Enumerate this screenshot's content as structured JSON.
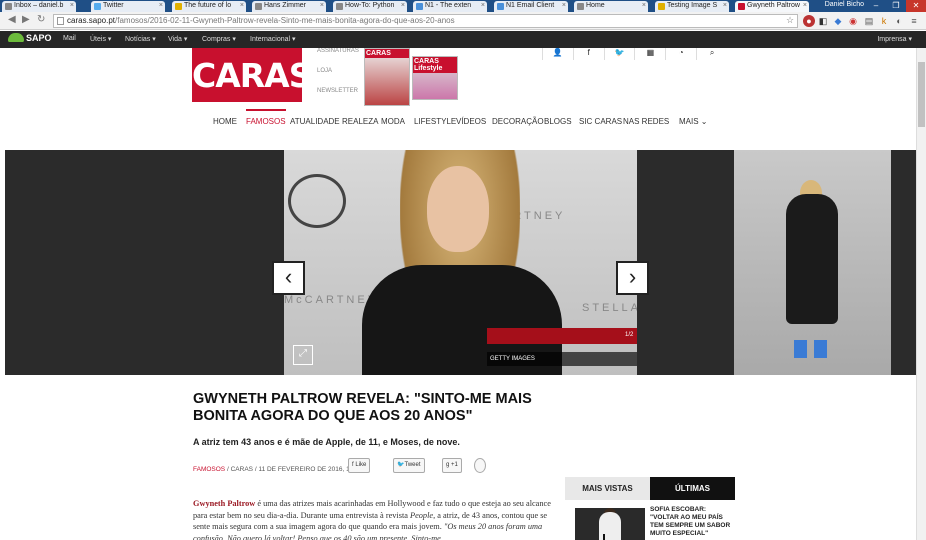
{
  "browser": {
    "tabs": [
      {
        "title": "Inbox – daniel.b",
        "active": false
      },
      {
        "title": "Twitter",
        "active": false
      },
      {
        "title": "The future of lo",
        "active": false
      },
      {
        "title": "Hans Zimmer",
        "active": false
      },
      {
        "title": "How-To: Python",
        "active": false
      },
      {
        "title": "N1 - The exten",
        "active": false
      },
      {
        "title": "N1 Email Client",
        "active": false
      },
      {
        "title": "Home",
        "active": false
      },
      {
        "title": "Testing Image S",
        "active": false
      },
      {
        "title": "Gwyneth Paltrow",
        "active": true
      }
    ],
    "user": "Daniel Bicho",
    "url_host": "caras.sapo.pt",
    "url_path": "/famosos/2016-02-11-Gwyneth-Paltrow-revela-Sinto-me-mais-bonita-agora-do-que-aos-20-anos",
    "colors": {
      "tabbar": "#1f4f86",
      "close": "#c7362b"
    }
  },
  "sapo_bar": {
    "logo": "SAPO",
    "links": [
      "Mail",
      "Úteis ▾",
      "Notícias ▾",
      "Vida ▾",
      "Compras ▾",
      "Internacional ▾"
    ],
    "right": "Imprensa ▾"
  },
  "site": {
    "logo": "CARAS",
    "side_links": [
      "ASSINATURAS",
      "LOJA",
      "NEWSLETTER"
    ],
    "magazines": [
      "CARAS",
      "CARAS Lifestyle"
    ],
    "nav": [
      "HOME",
      "FAMOSOS",
      "ATUALIDADE",
      "REALEZA",
      "MODA",
      "LIFESTYLE",
      "VÍDEOS",
      "DECORAÇÃO",
      "BLOGS",
      "SIC CARAS",
      "NAS REDES",
      "MAIS"
    ],
    "active_nav": "FAMOSOS",
    "accent": "#c8102e"
  },
  "gallery": {
    "counter": "1/2",
    "credit": "GETTY IMAGES",
    "wall_texts": [
      "McCARTNEY",
      "STELLA",
      "CARTNEY"
    ]
  },
  "article": {
    "title": "GWYNETH PALTROW REVELA: \"SINTO-ME MAIS BONITA AGORA DO QUE AOS 20 ANOS\"",
    "lead": "A atriz tem 43 anos e é mãe de Apple, de 11, e Moses, de nove.",
    "category": "FAMOSOS",
    "section": "CARAS",
    "date": "11 DE FEVEREIRO DE 2016, 18:09",
    "share": [
      "Like",
      "Tweet",
      "+1"
    ],
    "name": "Gwyneth Paltrow",
    "body_1": " é uma das atrizes mais acarinhadas em Hollywood e faz tudo o que esteja ao seu alcance para estar bem no seu dia-a-dia. Durante uma entrevista à revista ",
    "body_source": "People",
    "body_2": ", a atriz, de 43 anos, contou que se sente mais segura com a sua imagem agora do que quando era mais jovem. ",
    "body_quote": "\"Os meus 20 anos foram uma confusão. Não quero lá voltar! Penso que os 40 são um presente. Sinto-me"
  },
  "sidebar": {
    "tab_most_viewed": "MAIS VISTAS",
    "tab_latest": "ÚLTIMAS",
    "latest_item": "SOFIA ESCOBAR: \"VOLTAR AO MEU PAÍS TEM SEMPRE UM SABOR MUITO ESPECIAL\""
  }
}
